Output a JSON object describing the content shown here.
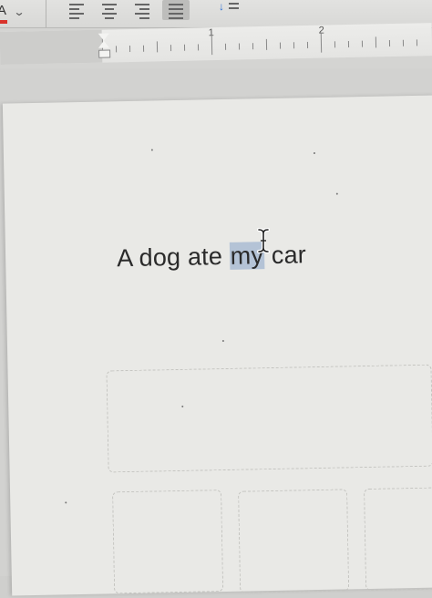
{
  "toolbar": {
    "font_color_label": "A",
    "font_color_hex": "#d9332b",
    "dropdown_icon": "chevron-down-icon",
    "alignment_buttons": [
      {
        "name": "align-left",
        "icon": "align-left-icon",
        "active": false
      },
      {
        "name": "align-center",
        "icon": "align-center-icon",
        "active": false
      },
      {
        "name": "align-right",
        "icon": "align-right-icon",
        "active": false
      },
      {
        "name": "justify",
        "icon": "justify-icon",
        "active": true
      }
    ],
    "line_spacing_icon": "line-spacing-icon"
  },
  "ruler": {
    "numbers": [
      "1",
      "2"
    ]
  },
  "document": {
    "before_selection": "A dog ate ",
    "selected_text": "my",
    "after_selection": " car",
    "selection_color": "#b4c3d6",
    "cursor": "i-beam-cursor-icon"
  }
}
